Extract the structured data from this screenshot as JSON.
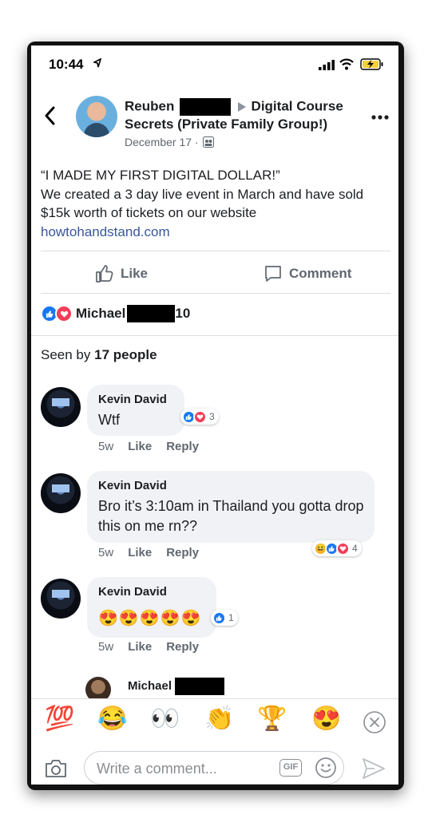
{
  "status_bar": {
    "time": "10:44"
  },
  "header": {
    "author": "Reuben",
    "group_line1": "Digital Course",
    "group_line2": "Secrets (Private Family Group!)",
    "date": "December 17 ·"
  },
  "post": {
    "line1": "“I MADE MY FIRST DIGITAL DOLLAR!”",
    "body": "We created a 3 day live event in March and have sold $15k worth of tickets on our website",
    "link": "howtohandstand.com"
  },
  "actions": {
    "like": "Like",
    "comment": "Comment"
  },
  "reactions": {
    "name": "Michael",
    "count_suffix": "10"
  },
  "seen": {
    "prefix": "Seen by ",
    "count": "17 people"
  },
  "comments": [
    {
      "author": "Kevin David",
      "text": "Wtf",
      "time": "5w",
      "like": "Like",
      "reply": "Reply",
      "reaction_count": "3"
    },
    {
      "author": "Kevin David",
      "text": "Bro it’s 3:10am in Thailand you gotta drop this on me rn??",
      "time": "5w",
      "like": "Like",
      "reply": "Reply",
      "reaction_count": "4"
    },
    {
      "author": "Kevin David",
      "text": "😍😍😍😍😍",
      "time": "5w",
      "like": "Like",
      "reply": "Reply",
      "reaction_count": "1"
    }
  ],
  "partial_comment": {
    "author": "Michael"
  },
  "emoji_bar": [
    "💯",
    "😂",
    "👀",
    "👏",
    "🏆",
    "😍"
  ],
  "composer": {
    "placeholder": "Write a comment...",
    "gif": "GIF"
  },
  "colors": {
    "facebook_blue": "#1877f2",
    "link": "#385898",
    "love": "#f33e58",
    "bubble": "#f0f2f5"
  }
}
